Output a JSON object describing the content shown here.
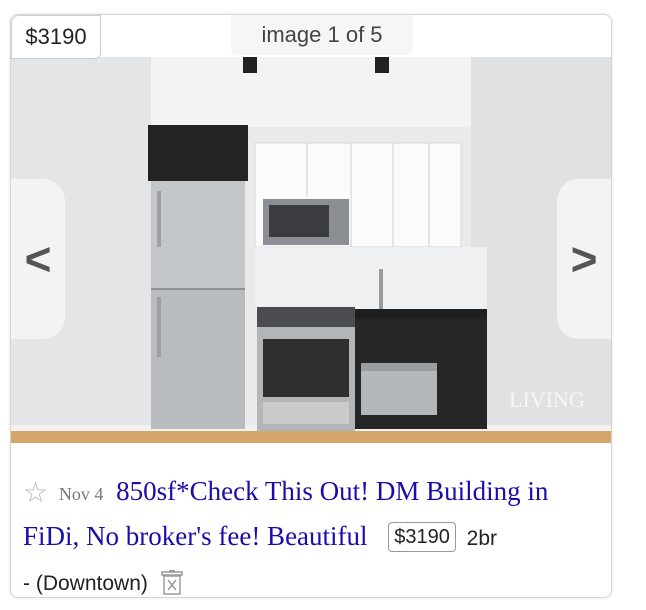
{
  "listing": {
    "price_badge": "$3190",
    "image_counter": "image 1 of 5",
    "prev_label": "<",
    "next_label": ">",
    "star_glyph": "☆",
    "date": "Nov 4",
    "title": "850sf*Check This Out! DM Building in FiDi, No broker's fee! Beautiful",
    "price": "$3190",
    "housing": "2br",
    "neighborhood": "- (Downtown)",
    "watermark": "LIVING"
  },
  "colors": {
    "link": "#1a0dab",
    "text": "#222222"
  },
  "icons": [
    "star-icon",
    "trash-icon",
    "chevron-left-icon",
    "chevron-right-icon"
  ]
}
